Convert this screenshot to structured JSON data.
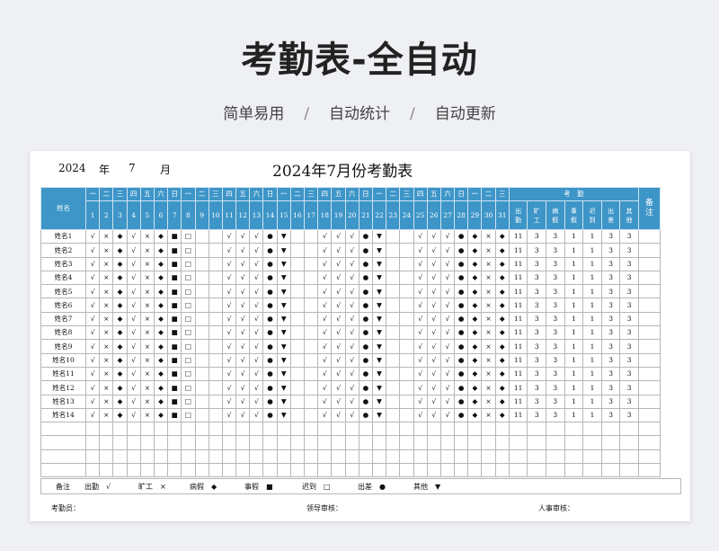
{
  "header": {
    "title": "考勤表-全自动",
    "subtitle": [
      "简单易用",
      "自动统计",
      "自动更新"
    ],
    "separator": "/"
  },
  "sheet": {
    "year": "2024",
    "year_unit": "年",
    "month": "7",
    "month_unit": "月",
    "title": "2024年7月份考勤表",
    "name_header": "姓名",
    "remark_header": "备注",
    "stats_header": "考　勤",
    "weekdays": [
      "一",
      "二",
      "三",
      "四",
      "五",
      "六",
      "日",
      "一",
      "二",
      "三",
      "四",
      "五",
      "六",
      "日",
      "一",
      "二",
      "三",
      "四",
      "五",
      "六",
      "日",
      "一",
      "二",
      "三",
      "四",
      "五",
      "六",
      "日",
      "一",
      "二",
      "三"
    ],
    "days": [
      "1",
      "2",
      "3",
      "4",
      "5",
      "6",
      "7",
      "8",
      "9",
      "10",
      "11",
      "12",
      "13",
      "14",
      "15",
      "16",
      "17",
      "18",
      "19",
      "20",
      "21",
      "22",
      "23",
      "24",
      "25",
      "26",
      "27",
      "28",
      "29",
      "30",
      "31"
    ],
    "stat_headers": [
      "出勤",
      "旷工",
      "病假",
      "事假",
      "迟到",
      "出差",
      "其他"
    ],
    "employees": [
      "姓名1",
      "姓名2",
      "姓名3",
      "姓名4",
      "姓名5",
      "姓名6",
      "姓名7",
      "姓名8",
      "姓名9",
      "姓名10",
      "姓名11",
      "姓名12",
      "姓名13",
      "姓名14"
    ],
    "day_marks": [
      "√",
      "×",
      "◆",
      "√",
      "×",
      "◆",
      "■",
      "□",
      "",
      "",
      "√",
      "√",
      "√",
      "●",
      "▼",
      "",
      "",
      "√",
      "√",
      "√",
      "●",
      "▼",
      "",
      "",
      "√",
      "√",
      "√",
      "●",
      "◆",
      "×",
      "◆"
    ],
    "stat_values": [
      "11",
      "3",
      "3",
      "1",
      "1",
      "3",
      "3"
    ],
    "empty_rows": 4,
    "legend": [
      {
        "label": "备注"
      },
      {
        "label": "出勤",
        "symbol": "√"
      },
      {
        "label": "旷工",
        "symbol": "×"
      },
      {
        "label": "病假",
        "symbol": "◆"
      },
      {
        "label": "事假",
        "symbol": "■"
      },
      {
        "label": "迟到",
        "symbol": "□"
      },
      {
        "label": "出差",
        "symbol": "●"
      },
      {
        "label": "其他",
        "symbol": "▼"
      }
    ],
    "footer": {
      "clerk": "考勤员：",
      "leader": "领导审核：",
      "hr": "人事审核："
    }
  }
}
